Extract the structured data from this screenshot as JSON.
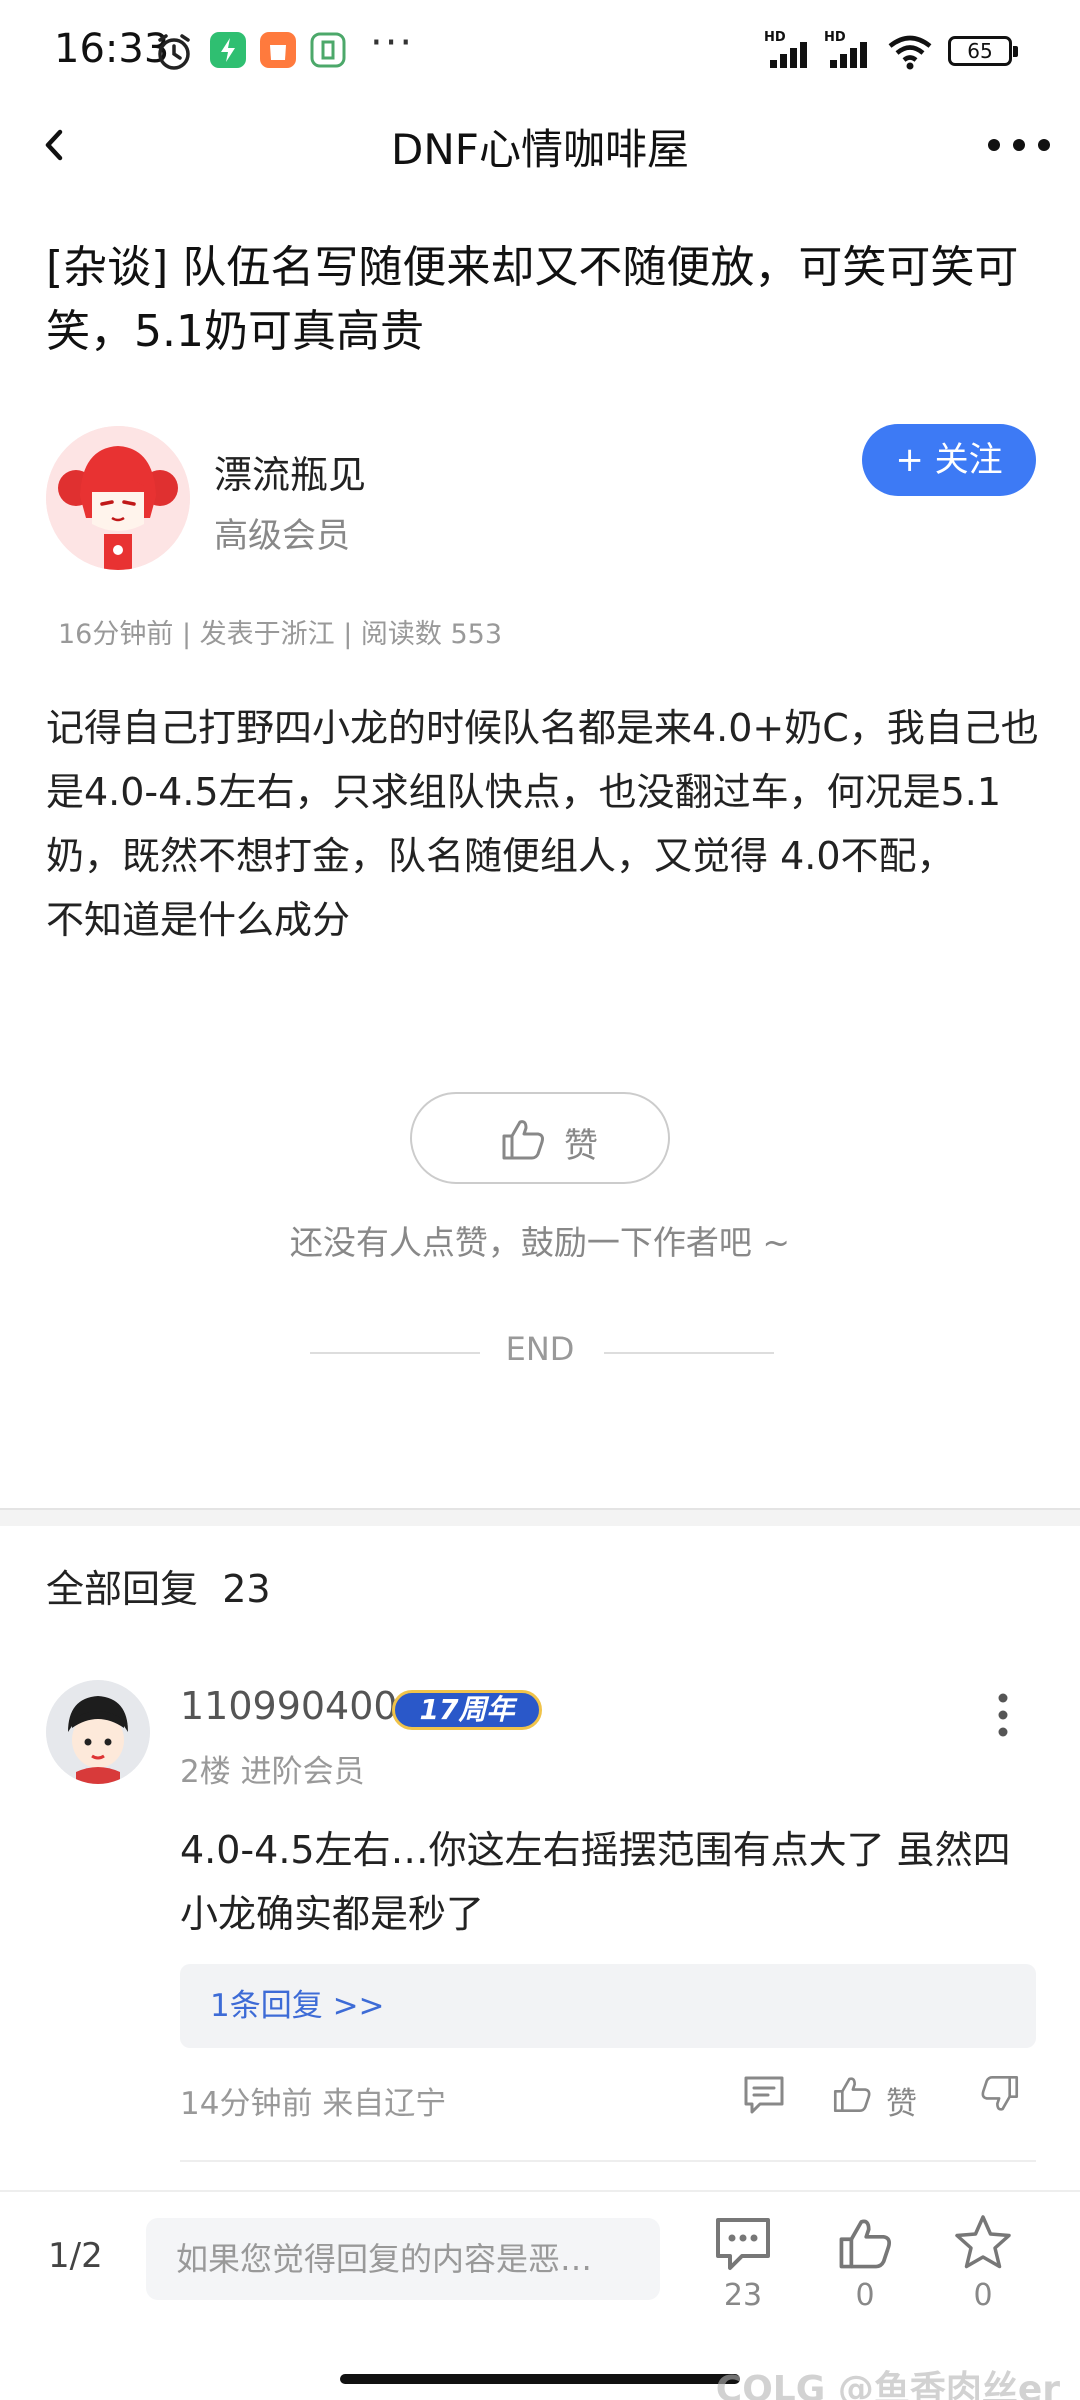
{
  "status_bar": {
    "time": "16:33",
    "battery": "65"
  },
  "nav": {
    "title": "DNF心情咖啡屋"
  },
  "post": {
    "title": "[杂谈] 队伍名写随便来却又不随便放，可笑可笑可笑，5.1奶可真高贵",
    "author": {
      "name": "漂流瓶见",
      "level": "高级会员"
    },
    "follow_label": "+ 关注",
    "meta": "16分钟前 | 发表于浙江 | 阅读数 553",
    "body_line1": "记得自己打野四小龙的时候队名都是来4.0+奶C，我自己也是4.0-4.5左右，只求组队快点，也没翻过车，何况是5.1奶，既然不想打金，队名随便组人，又觉得 4.0不配，",
    "body_line2": "不知道是什么成分",
    "like_label": "赞",
    "like_hint": "还没有人点赞，鼓励一下作者吧 ~",
    "end_label": "END"
  },
  "replies": {
    "header": "全部回复",
    "count": "23",
    "items": [
      {
        "name": "110990400",
        "badge": "17周年",
        "sub": "2楼 进阶会员",
        "text": "4.0-4.5左右…你这左右摇摆范围有点大了 虽然四小龙确实都是秒了",
        "sub_replies": "1条回复 >>",
        "time": "14分钟前 来自辽宁",
        "like_label": "赞"
      }
    ]
  },
  "bottom_bar": {
    "pager": "1/2",
    "input_placeholder": "如果您觉得回复的内容是恶…",
    "comment_count": "23",
    "like_count": "0",
    "star_count": "0"
  },
  "watermark": "COLG @鱼香肉丝er"
}
